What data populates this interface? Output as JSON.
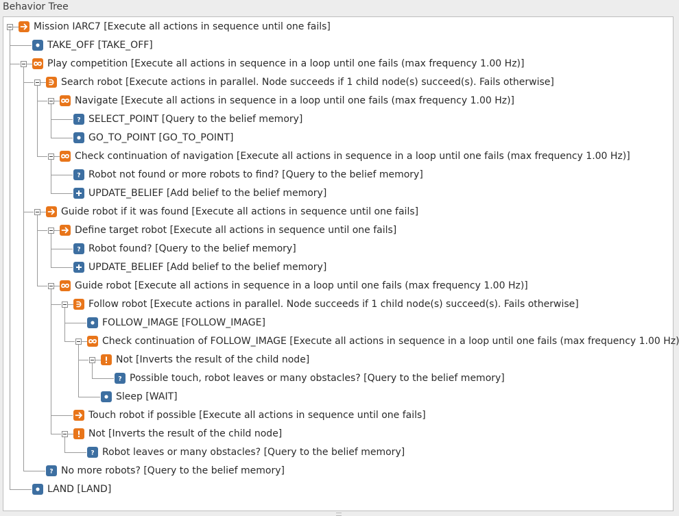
{
  "panel": {
    "title": "Behavior Tree"
  },
  "colors": {
    "orange": "#e8751a",
    "blue": "#3d6fa1"
  },
  "nodes": [
    {
      "label": "Mission IARC7 [Execute all actions in sequence until one fails]",
      "icon": "sequence-arrow-icon"
    },
    {
      "label": "TAKE_OFF [TAKE_OFF]",
      "icon": "action-dot-icon"
    },
    {
      "label": "Play competition [Execute all actions in sequence in a loop until one fails (max frequency 1.00 Hz)]",
      "icon": "loop-icon"
    },
    {
      "label": "Search robot [Execute actions in parallel. Node succeeds if 1 child node(s) succeed(s). Fails otherwise]",
      "icon": "parallel-icon"
    },
    {
      "label": "Navigate [Execute all actions in sequence in a loop until one fails (max frequency 1.00 Hz)]",
      "icon": "loop-icon"
    },
    {
      "label": "SELECT_POINT [Query to the belief memory]",
      "icon": "query-icon"
    },
    {
      "label": "GO_TO_POINT [GO_TO_POINT]",
      "icon": "action-dot-icon"
    },
    {
      "label": "Check continuation of navigation [Execute all actions in sequence in a loop until one fails (max frequency 1.00 Hz)]",
      "icon": "loop-icon"
    },
    {
      "label": "Robot not found or more robots to find? [Query to the belief memory]",
      "icon": "query-icon"
    },
    {
      "label": "UPDATE_BELIEF [Add belief to the belief memory]",
      "icon": "add-belief-icon"
    },
    {
      "label": "Guide robot if it was found [Execute all actions in sequence until one fails]",
      "icon": "sequence-arrow-icon"
    },
    {
      "label": "Define target robot [Execute all actions in sequence until one fails]",
      "icon": "sequence-arrow-icon"
    },
    {
      "label": "Robot found? [Query to the belief memory]",
      "icon": "query-icon"
    },
    {
      "label": "UPDATE_BELIEF [Add belief to the belief memory]",
      "icon": "add-belief-icon"
    },
    {
      "label": "Guide robot [Execute all actions in sequence in a loop until one fails (max frequency 1.00 Hz)]",
      "icon": "loop-icon"
    },
    {
      "label": "Follow robot [Execute actions in parallel. Node succeeds if 1 child node(s) succeed(s). Fails otherwise]",
      "icon": "parallel-icon"
    },
    {
      "label": "FOLLOW_IMAGE [FOLLOW_IMAGE]",
      "icon": "action-dot-icon"
    },
    {
      "label": "Check continuation of FOLLOW_IMAGE [Execute all actions in sequence in a loop until one fails (max frequency 1.00 Hz)]",
      "icon": "loop-icon"
    },
    {
      "label": "Not [Inverts the result of the child node]",
      "icon": "inverter-icon"
    },
    {
      "label": "Possible touch, robot leaves or many obstacles? [Query to the belief memory]",
      "icon": "query-icon"
    },
    {
      "label": "Sleep [WAIT]",
      "icon": "action-dot-icon"
    },
    {
      "label": "Touch robot if possible [Execute all actions in sequence until one fails]",
      "icon": "sequence-arrow-icon"
    },
    {
      "label": "Not [Inverts the result of the child node]",
      "icon": "inverter-icon"
    },
    {
      "label": "Robot leaves or many obstacles? [Query to the belief memory]",
      "icon": "query-icon"
    },
    {
      "label": "No more robots? [Query to the belief memory]",
      "icon": "query-icon"
    },
    {
      "label": "LAND [LAND]",
      "icon": "action-dot-icon"
    }
  ]
}
